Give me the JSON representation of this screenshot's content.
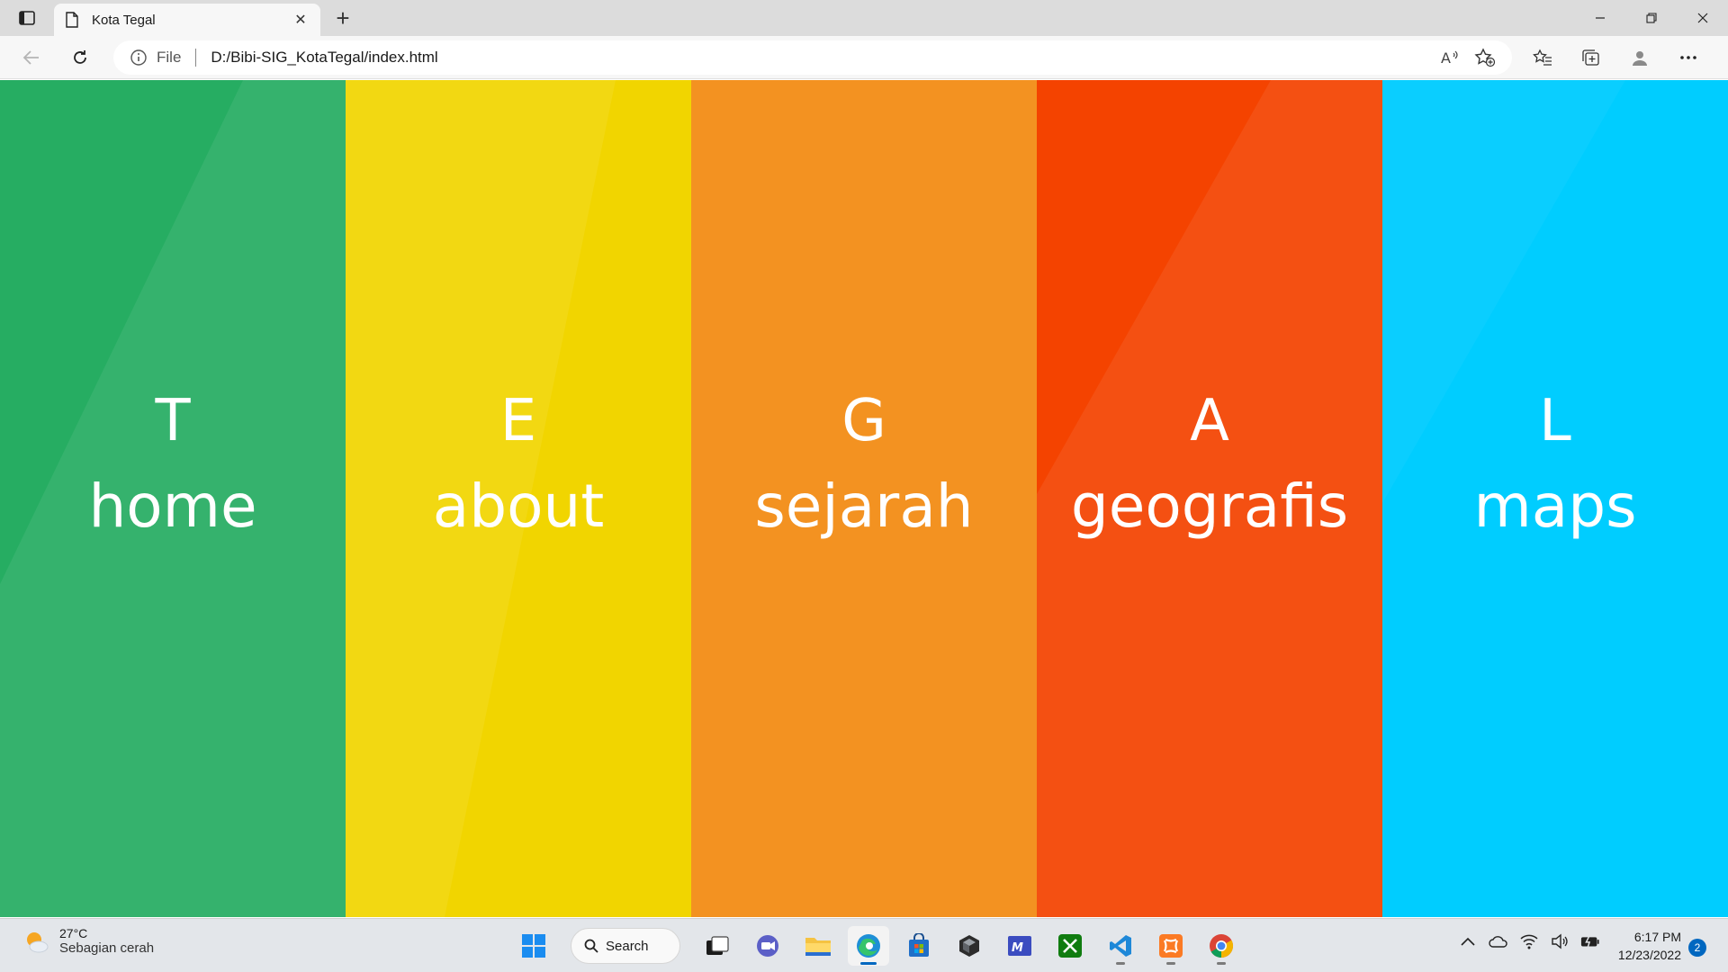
{
  "browser": {
    "tab_title": "Kota Tegal",
    "address_scheme": "File",
    "address_url": "D:/Bibi-SIG_KotaTegal/index.html"
  },
  "panels": [
    {
      "letter": "T",
      "label": "home",
      "color": "#26ad62"
    },
    {
      "letter": "E",
      "label": "about",
      "color": "#f1d500"
    },
    {
      "letter": "G",
      "label": "sejarah",
      "color": "#f3901d"
    },
    {
      "letter": "A",
      "label": "geografis",
      "color": "#f44300"
    },
    {
      "letter": "L",
      "label": "maps",
      "color": "#00cdff"
    }
  ],
  "taskbar": {
    "weather_temp": "27°C",
    "weather_desc": "Sebagian cerah",
    "search_label": "Search",
    "time": "6:17 PM",
    "date": "12/23/2022",
    "notification_count": "2"
  }
}
